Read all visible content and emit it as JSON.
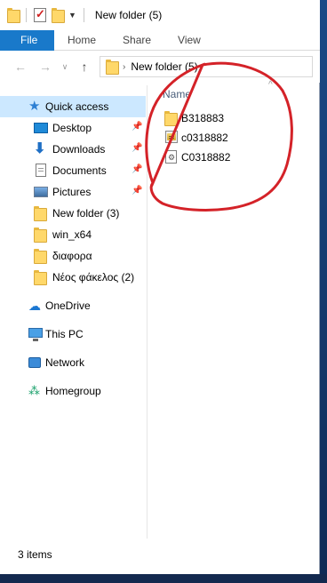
{
  "window": {
    "title": "New folder (5)"
  },
  "ribbon": {
    "tabs": [
      {
        "label": "File"
      },
      {
        "label": "Home"
      },
      {
        "label": "Share"
      },
      {
        "label": "View"
      }
    ]
  },
  "address": {
    "path": "New folder (5)"
  },
  "navpane": {
    "items": [
      {
        "label": "Quick access",
        "icon": "star-icon",
        "selected": true
      },
      {
        "label": "Desktop",
        "icon": "desktop-icon",
        "pinned": true
      },
      {
        "label": "Downloads",
        "icon": "download-icon",
        "pinned": true
      },
      {
        "label": "Documents",
        "icon": "documents-icon",
        "pinned": true
      },
      {
        "label": "Pictures",
        "icon": "pictures-icon",
        "pinned": true
      },
      {
        "label": "New folder (3)",
        "icon": "folder-icon"
      },
      {
        "label": "win_x64",
        "icon": "folder-icon"
      },
      {
        "label": "διαφορα",
        "icon": "folder-icon"
      },
      {
        "label": "Νέος φάκελος (2)",
        "icon": "folder-icon"
      },
      {
        "label": "OneDrive",
        "icon": "cloud-icon"
      },
      {
        "label": "This PC",
        "icon": "computer-icon"
      },
      {
        "label": "Network",
        "icon": "network-icon"
      },
      {
        "label": "Homegroup",
        "icon": "homegroup-icon"
      }
    ]
  },
  "content": {
    "column_header": "Name",
    "files": [
      {
        "name": "B318883",
        "icon": "folder-icon"
      },
      {
        "name": "c0318882",
        "icon": "batch-file-icon"
      },
      {
        "name": "C0318882",
        "icon": "config-file-icon"
      }
    ]
  },
  "annotation": {
    "color": "#d42228"
  },
  "status": {
    "item_count": "3 items"
  },
  "colors": {
    "accent": "#1979ca",
    "selected_bg": "#cce8ff"
  }
}
